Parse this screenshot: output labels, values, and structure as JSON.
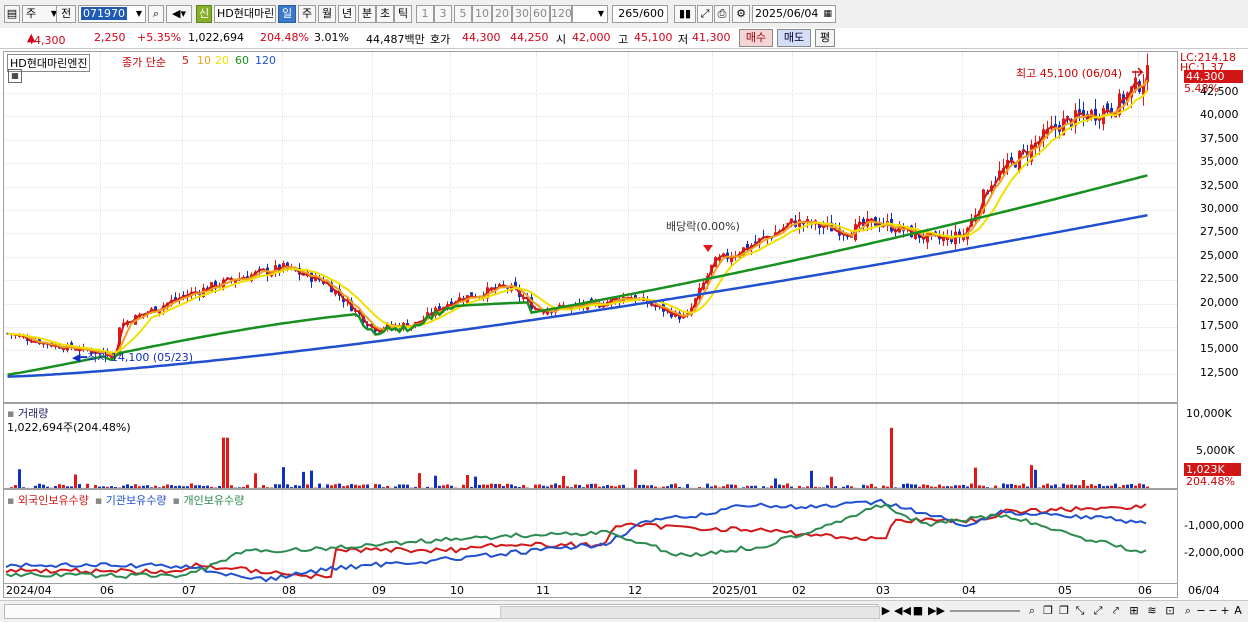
{
  "toolbar": {
    "period_type": "주",
    "prev_label": "전",
    "code": "071970",
    "stock_name": "HD현대마린",
    "new_badge": "신",
    "periods": [
      "일",
      "주",
      "월",
      "년",
      "분",
      "초",
      "틱"
    ],
    "numbers": [
      "1",
      "3",
      "5",
      "10",
      "20",
      "30",
      "60",
      "120"
    ],
    "count": "265",
    "count_total": "/600",
    "date": "2025/06/04"
  },
  "quote": {
    "price": "44,300",
    "change": "2,250",
    "change_pct": "+5.35%",
    "volume": "1,022,694",
    "volume_ratio": "204.48%",
    "turnover": "3.01%",
    "amount": "44,487백만",
    "bid_label": "호가",
    "ask": "44,300",
    "bid": "44,250",
    "open_label": "시",
    "open": "42,000",
    "high_label": "고",
    "high": "45,100",
    "low_label": "저",
    "low": "41,300",
    "buy_label": "매수",
    "sell_label": "매도",
    "flat_label": "평"
  },
  "price_pane": {
    "name": "HD현대마린엔진",
    "ma_label": "종가 단순",
    "ma_periods": [
      "5",
      "10",
      "20",
      "60",
      "120"
    ],
    "ma_colors": [
      "#d01818",
      "#f0a020",
      "#f0e000",
      "#189020",
      "#2050d0"
    ],
    "high_note": "최고 45,100 (06/04)",
    "low_note": "최저 14,100 (05/23)",
    "dividend_note": "배당락(0.00%)",
    "lc_value": "LC:214.18",
    "hc_value": "HC:1.37",
    "current_tag": "44,300",
    "pct_tag": "5.48%",
    "y_ticks": [
      "42,500",
      "40,000",
      "37,500",
      "35,000",
      "32,500",
      "30,000",
      "27,500",
      "25,000",
      "22,500",
      "20,000",
      "17,500",
      "15,000",
      "12,500"
    ]
  },
  "volume_pane": {
    "title": "거래량",
    "value": "1,022,694주(204.48%)",
    "y_ticks": [
      "10,000K",
      "5,000K"
    ],
    "current_tag": "1,023K",
    "pct_tag": "204.48%"
  },
  "holdings_pane": {
    "series": [
      {
        "name": "외국인보유수량",
        "color": "#d01818"
      },
      {
        "name": "기관보유수량",
        "color": "#2050d0"
      },
      {
        "name": "개인보유수량",
        "color": "#2a8a50"
      }
    ],
    "y_ticks": [
      "-1,000,000",
      "-2,000,000"
    ]
  },
  "x_axis": {
    "labels": [
      "2024/04",
      "06",
      "07",
      "08",
      "09",
      "10",
      "11",
      "12",
      "2025/01",
      "02",
      "03",
      "04",
      "05",
      "06"
    ],
    "right_label": "06/04"
  },
  "chart_data": {
    "type": "candlestick",
    "title": "HD현대마린엔진",
    "x_range": [
      "2024/04",
      "2025/06/04"
    ],
    "ylim": [
      11000,
      45500
    ],
    "price_series": [
      {
        "date": "2024/04",
        "close": 16500
      },
      {
        "date": "2024/05",
        "close": 15200
      },
      {
        "date": "2024/05/23",
        "close": 14100
      },
      {
        "date": "2024/06",
        "close": 16500
      },
      {
        "date": "2024/07",
        "close": 20500
      },
      {
        "date": "2024/07/20",
        "close": 22500
      },
      {
        "date": "2024/08",
        "close": 23500
      },
      {
        "date": "2024/08/15",
        "close": 22000
      },
      {
        "date": "2024/09",
        "close": 17000
      },
      {
        "date": "2024/09/15",
        "close": 17500
      },
      {
        "date": "2024/10",
        "close": 20000
      },
      {
        "date": "2024/10/20",
        "close": 21500
      },
      {
        "date": "2024/11",
        "close": 19000
      },
      {
        "date": "2024/11/20",
        "close": 19500
      },
      {
        "date": "2024/12",
        "close": 20500
      },
      {
        "date": "2024/12/20",
        "close": 18000
      },
      {
        "date": "2025/01",
        "close": 24000
      },
      {
        "date": "2025/01/20",
        "close": 27000
      },
      {
        "date": "2025/02",
        "close": 28500
      },
      {
        "date": "2025/02/20",
        "close": 27500
      },
      {
        "date": "2025/03",
        "close": 28500
      },
      {
        "date": "2025/03/20",
        "close": 26500
      },
      {
        "date": "2025/04",
        "close": 27000
      },
      {
        "date": "2025/04/10",
        "close": 33000
      },
      {
        "date": "2025/05",
        "close": 39000
      },
      {
        "date": "2025/05/20",
        "close": 41000
      },
      {
        "date": "2025/06/04",
        "close": 44300
      }
    ],
    "ma60_end": 33500,
    "ma120_end": 29200,
    "volume_peaks_k": [
      {
        "date": "2024/07/15",
        "value": 8000
      },
      {
        "date": "2025/03/05",
        "value": 9500
      },
      {
        "date": "2025/04/25",
        "value": 3800
      }
    ]
  }
}
